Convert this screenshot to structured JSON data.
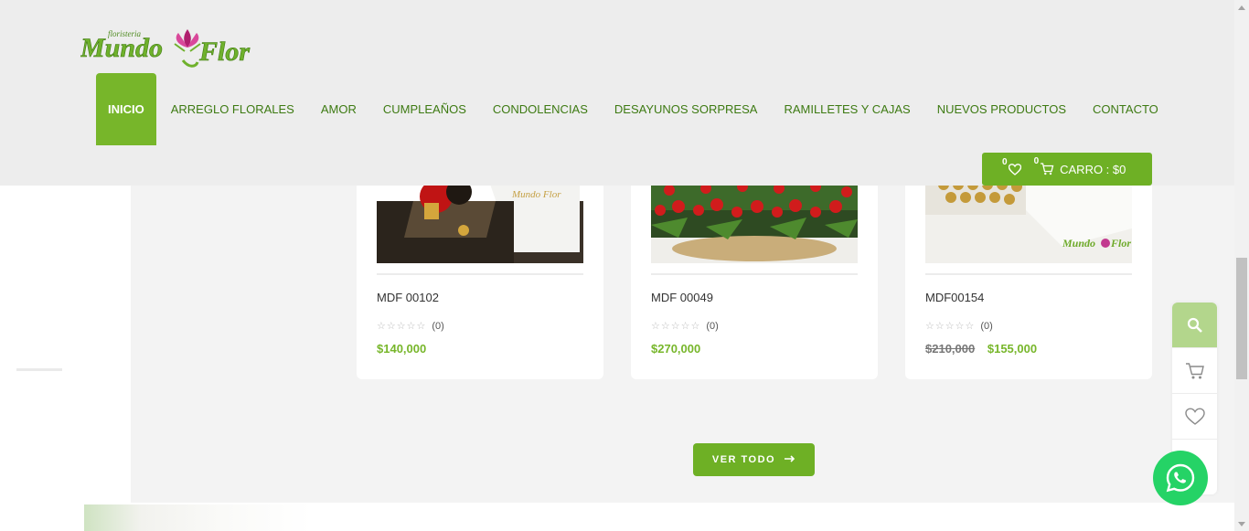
{
  "header": {
    "logo": {
      "small_text": "floristeria",
      "brand": "Mundo",
      "brand2": "Flor"
    },
    "nav": [
      {
        "label": "INICIO",
        "active": true
      },
      {
        "label": "ARREGLO FLORALES"
      },
      {
        "label": "AMOR"
      },
      {
        "label": "CUMPLEAÑOS"
      },
      {
        "label": "CONDOLENCIAS"
      },
      {
        "label": "DESAYUNOS SORPRESA"
      },
      {
        "label": "RAMILLETES Y CAJAS"
      },
      {
        "label": "NUEVOS PRODUCTOS"
      },
      {
        "label": "CONTACTO"
      }
    ],
    "cart": {
      "wishlist_count": "0",
      "cart_count": "0",
      "label": "CARRO : $0"
    }
  },
  "products": [
    {
      "name": "MDF 00102",
      "stars": "☆☆☆☆☆",
      "reviews": "(0)",
      "price": "$140,000",
      "old_price": ""
    },
    {
      "name": "MDF 00049",
      "stars": "☆☆☆☆☆",
      "reviews": "(0)",
      "price": "$270,000",
      "old_price": ""
    },
    {
      "name": "MDF00154",
      "stars": "☆☆☆☆☆",
      "reviews": "(0)",
      "price": "$155,000",
      "old_price": "$210,000"
    }
  ],
  "ver_todo": "VER TODO",
  "floating": {
    "icons": [
      "search-icon",
      "cart-icon",
      "heart-icon",
      "scroll-up-icon"
    ]
  },
  "colors": {
    "brand_green": "#77b62a",
    "header_bg": "#ededed",
    "price_green": "#77b62a",
    "whatsapp": "#25d366"
  }
}
